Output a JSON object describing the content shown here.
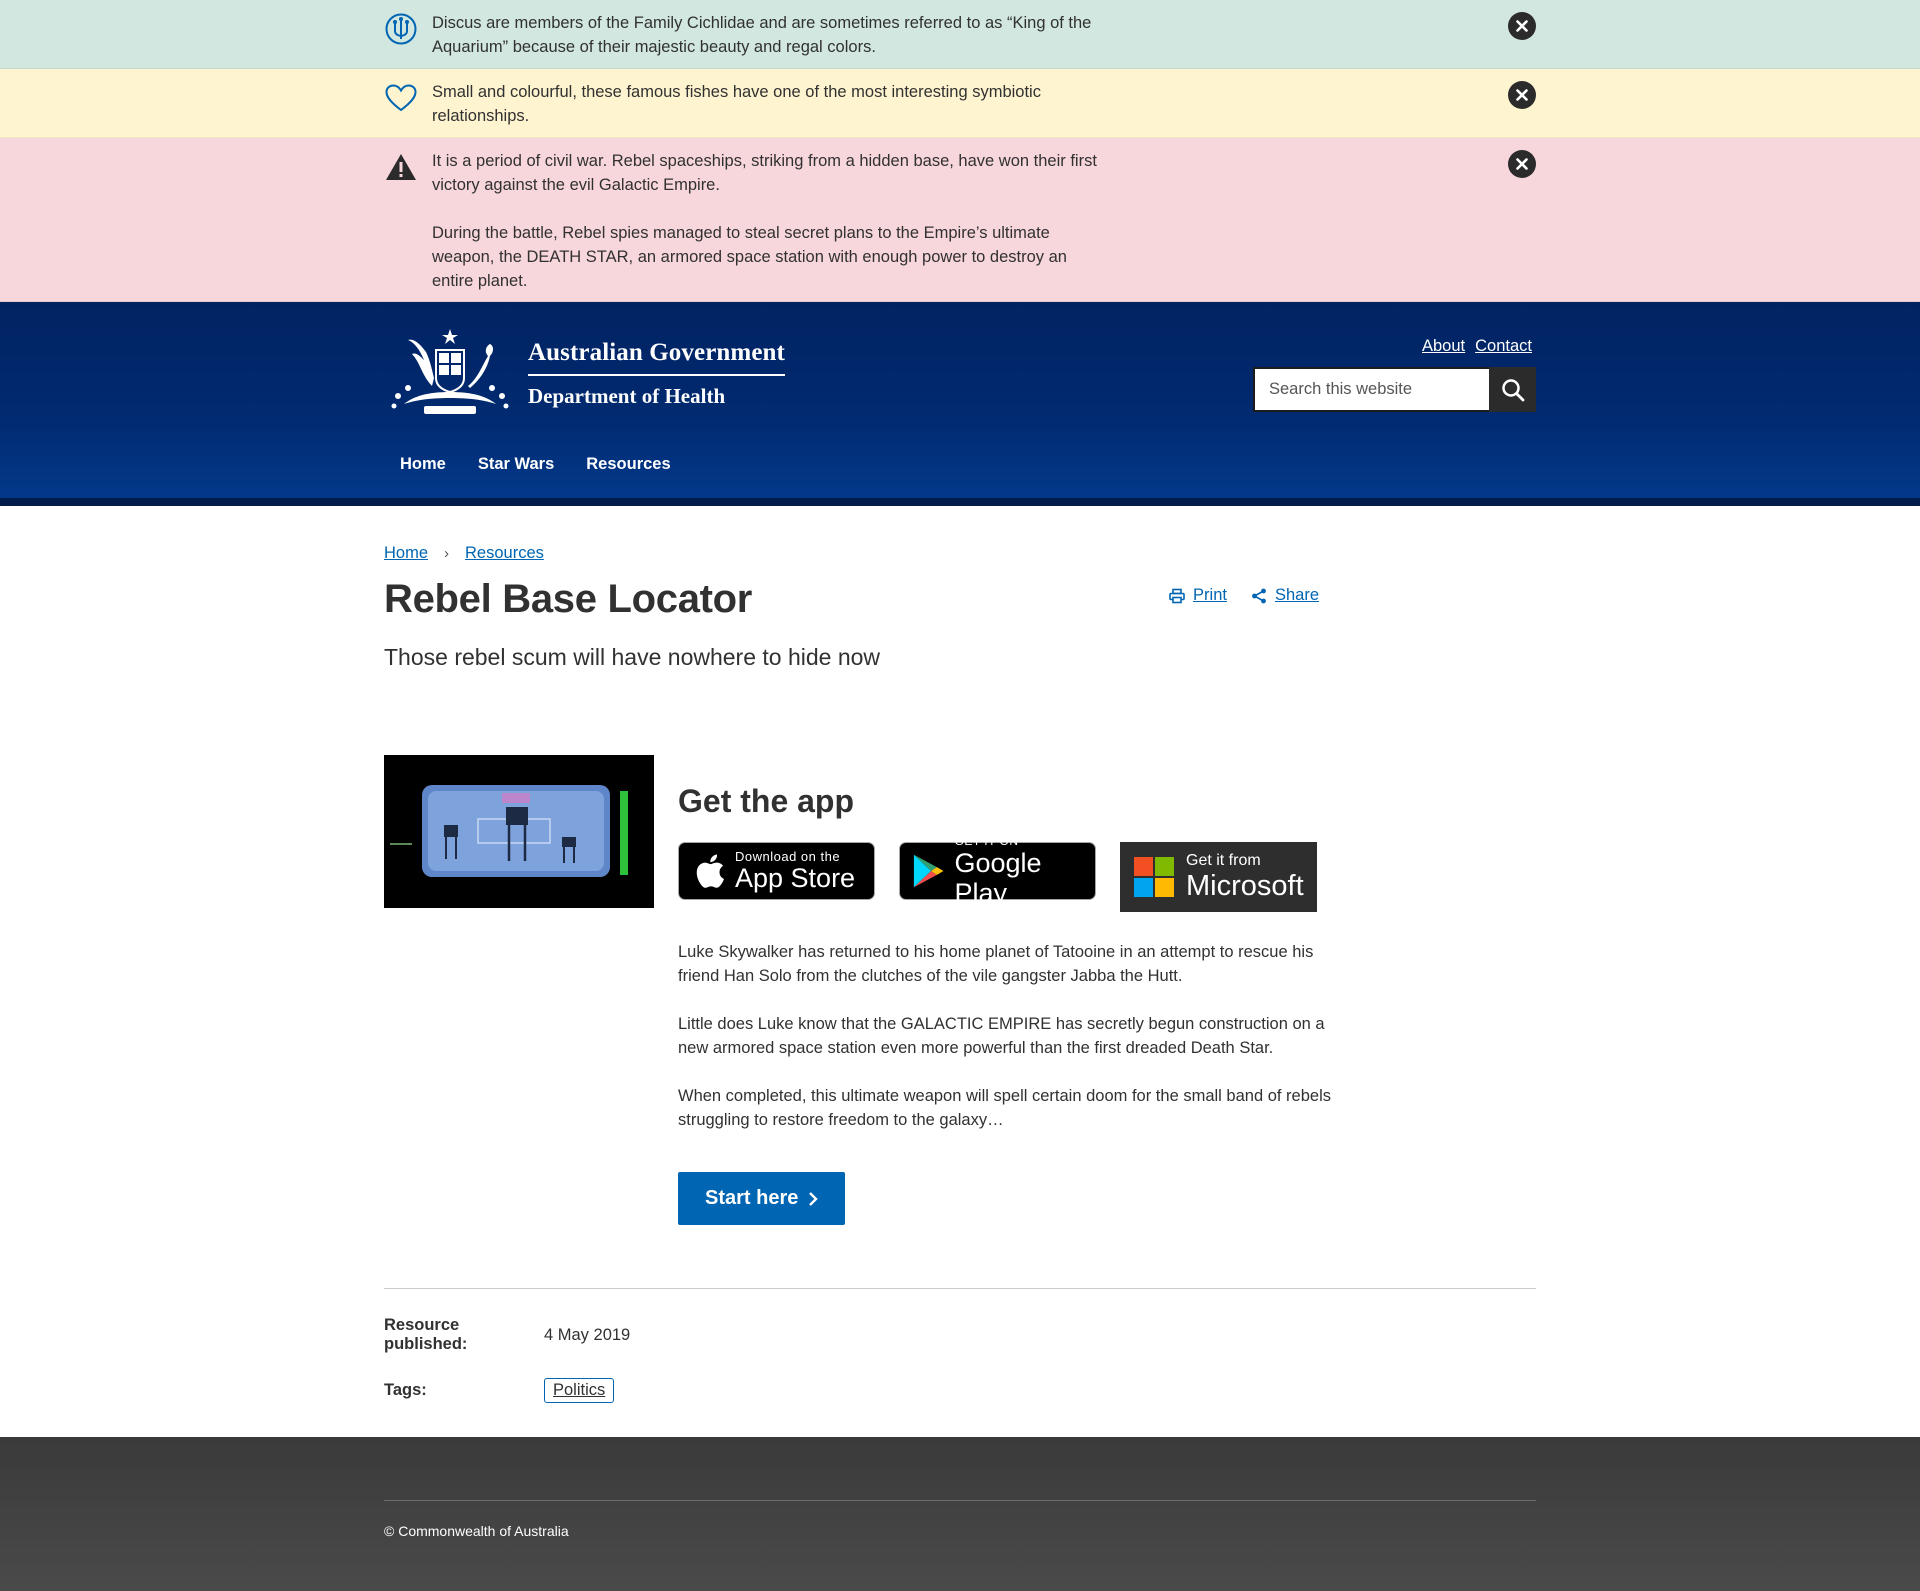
{
  "alerts": [
    {
      "type": "info",
      "icon": "discus-info-icon",
      "paragraphs": [
        "Discus are members of the Family Cichlidae and are sometimes referred to as “King of the Aquarium” because of their majestic beauty and regal colors."
      ]
    },
    {
      "type": "success",
      "icon": "heart-icon",
      "paragraphs": [
        "Small and colourful, these famous fishes have one of the most interesting symbiotic relationships."
      ]
    },
    {
      "type": "warning",
      "icon": "warning-icon",
      "paragraphs": [
        "It is a period of civil war. Rebel spaceships, striking from a hidden base, have won their first victory against the evil Galactic Empire.",
        "During the battle, Rebel spies managed to steal secret plans to the Empire’s ultimate weapon, the DEATH STAR, an armored space station with enough power to destroy an entire planet."
      ]
    }
  ],
  "header": {
    "logo_line1": "Australian Government",
    "logo_line2": "Department of Health",
    "links": [
      "About",
      "Contact"
    ],
    "search_placeholder": "Search this website",
    "nav": [
      "Home",
      "Star Wars",
      "Resources"
    ]
  },
  "breadcrumbs": [
    "Home",
    "Resources"
  ],
  "tools": {
    "print": "Print",
    "share": "Share"
  },
  "page": {
    "title": "Rebel Base Locator",
    "lede": "Those rebel scum will have nowhere to hide now"
  },
  "app": {
    "title": "Get the app",
    "apple": {
      "small": "Download on the",
      "big": "App Store"
    },
    "google": {
      "small": "GET IT ON",
      "big": "Google Play"
    },
    "microsoft": {
      "small": "Get it from",
      "big": "Microsoft"
    },
    "paragraphs": [
      "Luke Skywalker has returned to his home planet of Tatooine in an attempt to rescue his friend Han Solo from the clutches of the vile gangster Jabba the Hutt.",
      "Little does Luke know that the GALACTIC EMPIRE has secretly begun construction on a new armored space station even more powerful than the first dreaded Death Star.",
      "When completed, this ultimate weapon will spell certain doom for the small band of rebels struggling to restore freedom to the galaxy…"
    ],
    "cta": "Start here"
  },
  "meta": {
    "published_label": "Resource published:",
    "published_value": "4 May 2019",
    "tags_label": "Tags:",
    "tags": [
      "Politics"
    ]
  },
  "footer": {
    "copyright": "© Commonwealth of Australia"
  }
}
